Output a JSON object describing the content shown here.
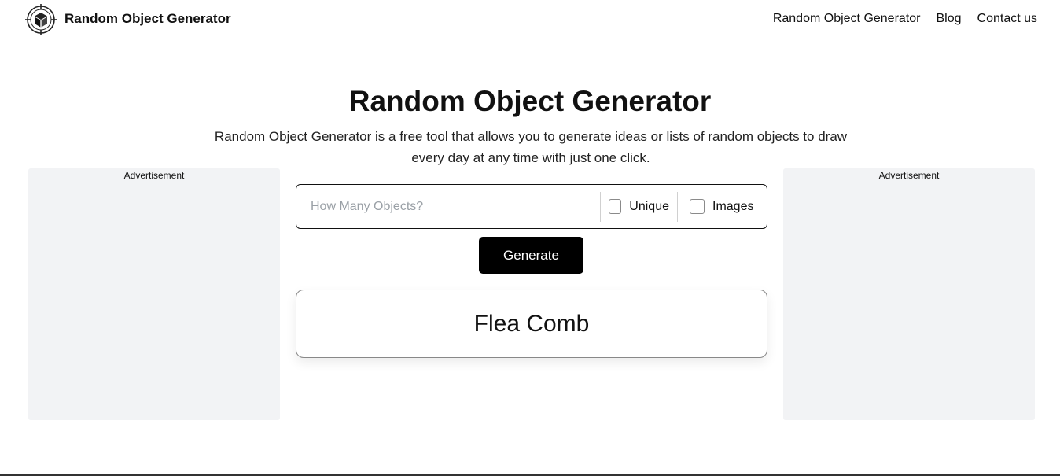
{
  "header": {
    "brand": "Random Object Generator",
    "nav": [
      "Random Object Generator",
      "Blog",
      "Contact us"
    ]
  },
  "main": {
    "title": "Random Object Generator",
    "description": "Random Object Generator is a free tool that allows you to generate ideas or lists of random objects to draw every day at any time with just one click.",
    "count_placeholder": "How Many Objects?",
    "count_value": "",
    "unique_label": "Unique",
    "unique_checked": false,
    "images_label": "Images",
    "images_checked": false,
    "generate_label": "Generate",
    "result": "Flea Comb"
  },
  "ads": {
    "left_label": "Advertisement",
    "right_label": "Advertisement"
  },
  "icons": {
    "logo": "crosshair-cube-icon",
    "checkbox": "checkbox-icon"
  },
  "colors": {
    "button_bg": "#000000",
    "ad_bg": "#f2f3f5",
    "text": "#111111"
  }
}
